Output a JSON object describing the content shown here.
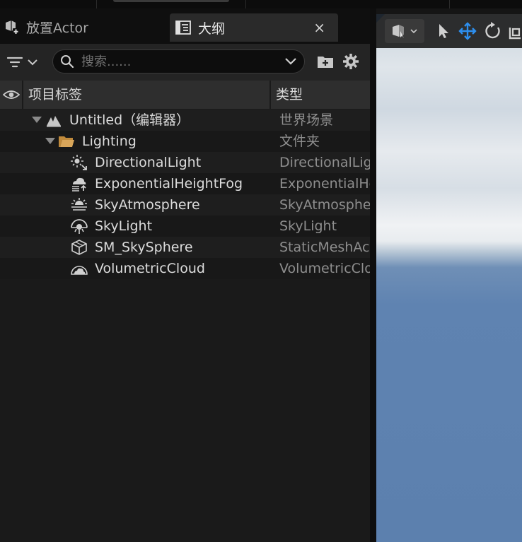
{
  "tabs": {
    "place_actors": "放置Actor",
    "outliner": "大纲",
    "close_glyph": "×"
  },
  "outliner": {
    "search_placeholder": "搜索......",
    "columns": {
      "label": "项目标签",
      "type": "类型"
    },
    "rows": [
      {
        "label": "Untitled（编辑器）",
        "type": "世界场景",
        "icon": "world-icon"
      },
      {
        "label": "Lighting",
        "type": "文件夹",
        "icon": "folder-icon"
      },
      {
        "label": "DirectionalLight",
        "type": "DirectionalLight",
        "icon": "directional-light-icon"
      },
      {
        "label": "ExponentialHeightFog",
        "type": "ExponentialHeightFog",
        "icon": "height-fog-icon"
      },
      {
        "label": "SkyAtmosphere",
        "type": "SkyAtmosphere",
        "icon": "sky-atmosphere-icon"
      },
      {
        "label": "SkyLight",
        "type": "SkyLight",
        "icon": "sky-light-icon"
      },
      {
        "label": "SM_SkySphere",
        "type": "StaticMeshActor",
        "icon": "static-mesh-icon"
      },
      {
        "label": "VolumetricCloud",
        "type": "VolumetricCloud",
        "icon": "volumetric-cloud-icon"
      }
    ]
  },
  "colors": {
    "accent_blue": "#1d7fe8",
    "folder": "#d9a65a",
    "panel_bg": "#1a1a1a",
    "sky_blue": "#5c80ae"
  }
}
